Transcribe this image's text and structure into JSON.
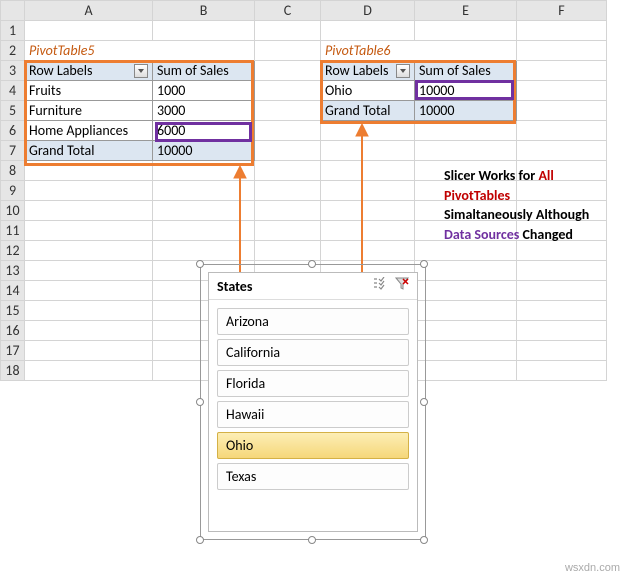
{
  "columns": [
    "A",
    "B",
    "C",
    "D",
    "E",
    "F"
  ],
  "rows": [
    "1",
    "2",
    "3",
    "4",
    "5",
    "6",
    "7",
    "8",
    "9",
    "10",
    "11",
    "12",
    "13",
    "14",
    "15",
    "16",
    "17",
    "18"
  ],
  "pt5": {
    "title": "PivotTable5",
    "row_labels": "Row Labels",
    "sum_label": "Sum of Sales",
    "rows": [
      {
        "label": "Fruits",
        "value": "1000"
      },
      {
        "label": "Furniture",
        "value": "3000"
      },
      {
        "label": "Home Appliances",
        "value": "6000"
      }
    ],
    "grand_label": "Grand Total",
    "grand_value": "10000"
  },
  "pt6": {
    "title": "PivotTable6",
    "row_labels": "Row Labels",
    "sum_label": "Sum of Sales",
    "rows": [
      {
        "label": "Ohio",
        "value": "10000"
      }
    ],
    "grand_label": "Grand Total",
    "grand_value": "10000"
  },
  "slicer": {
    "title": "States",
    "items": [
      "Arizona",
      "California",
      "Florida",
      "Hawaii",
      "Ohio",
      "Texas"
    ],
    "selected": "Ohio"
  },
  "note": {
    "l1a": "Slicer Works for ",
    "l1b": "All",
    "l2": "PivotTables",
    "l3": "Simaltaneously Although",
    "l4a": "Data Sources ",
    "l4b": "Changed"
  },
  "watermark": "wsxdn.com"
}
